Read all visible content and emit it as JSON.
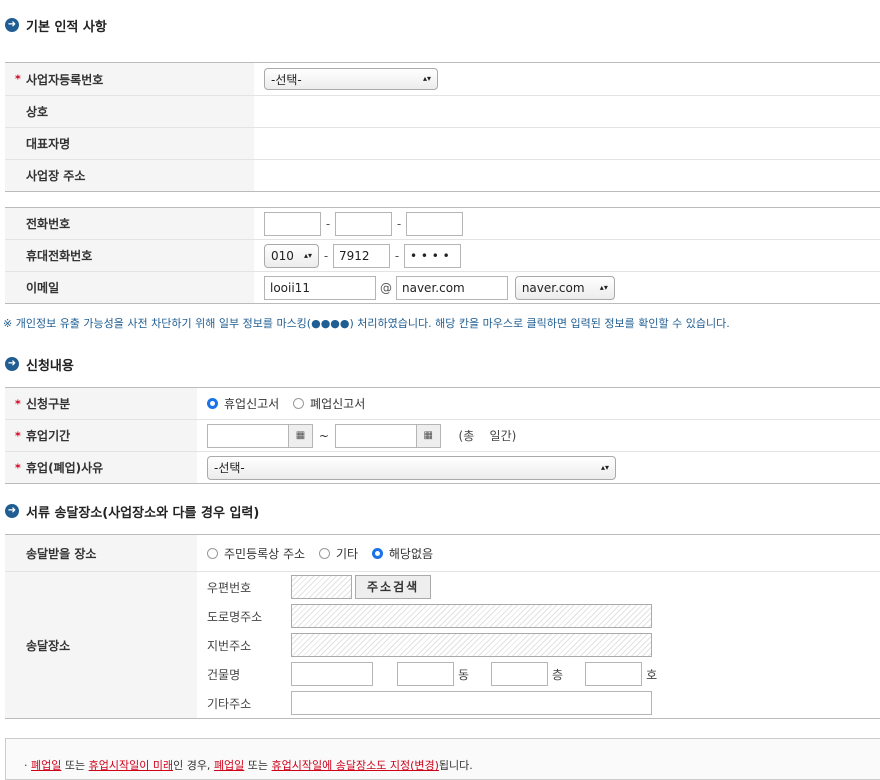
{
  "section1": {
    "title": "기본 인적 사항",
    "business_number_label": "사업자등록번호",
    "business_number_select": "-선택-",
    "company_label": "상호",
    "representative_label": "대표자명",
    "address_label": "사업장 주소"
  },
  "contact": {
    "phone_label": "전화번호",
    "phone": [
      "",
      "",
      ""
    ],
    "mobile_label": "휴대전화번호",
    "mobile_prefix": "010",
    "mobile_mid": "7912",
    "mobile_last": "• • • •",
    "email_label": "이메일",
    "email_id": "looii11",
    "email_at": "@",
    "email_domain": "naver.com",
    "email_domain_select": "naver.com",
    "dash": "-"
  },
  "notice": "※ 개인정보 유출 가능성을 사전 차단하기 위해 일부 정보를 마스킹(●●●●) 처리하였습니다. 해당 칸을 마우스로 클릭하면 입력된 정보를 확인할 수 있습니다.",
  "section2": {
    "title": "신청내용",
    "type_label": "신청구분",
    "type_options": [
      "휴업신고서",
      "폐업신고서"
    ],
    "period_label": "휴업기간",
    "period_tilde": "~",
    "period_total": "(총    일간)",
    "reason_label": "휴업(폐업)사유",
    "reason_select": "-선택-"
  },
  "section3": {
    "title": "서류 송달장소(사업장소와 다를 경우 입력)",
    "receive_label": "송달받을 장소",
    "receive_options": [
      "주민등록상 주소",
      "기타",
      "해당없음"
    ],
    "place_label": "송달장소",
    "postal_label": "우편번호",
    "search_button": "주소검색",
    "road_label": "도로명주소",
    "lot_label": "지번주소",
    "building_label": "건물명",
    "dong": "동",
    "floor": "층",
    "ho": "호",
    "etc_label": "기타주소"
  },
  "bottom": {
    "bullet": "·",
    "part1": "폐업일",
    "part2": " 또는 ",
    "part3": "휴업시작일이 미래",
    "part4": "인 경우, ",
    "part5": "폐업일",
    "part6": " 또는 ",
    "part7": "휴업시작일에 송달장소도 지정(변경)",
    "part8": "됩니다."
  },
  "required_mark": "*",
  "calendar_icon": "▦",
  "select_arrow": "▴▾",
  "section_icon": "➜"
}
